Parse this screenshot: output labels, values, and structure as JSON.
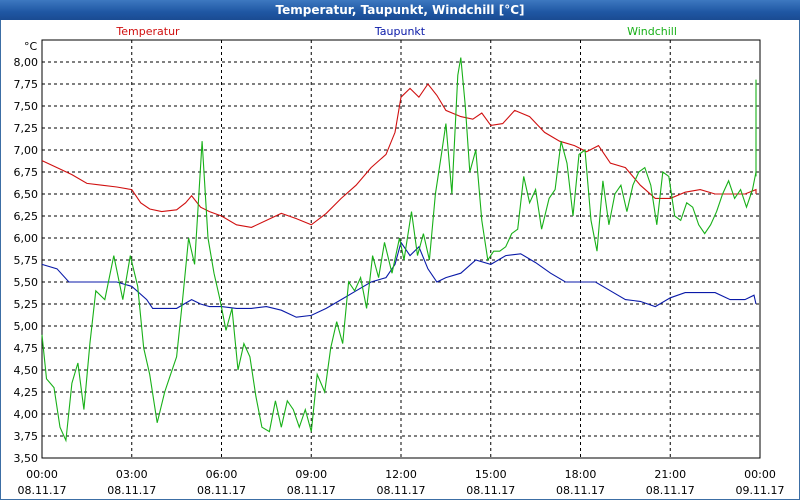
{
  "window": {
    "title": "Temperatur, Taupunkt, Windchill [°C]"
  },
  "chart_data": {
    "type": "line",
    "title": "Temperatur, Taupunkt, Windchill [°C]",
    "ylabel": "°C",
    "xlabel": "",
    "ylim": [
      3.5,
      8.25
    ],
    "xlim": [
      0,
      24
    ],
    "grid": true,
    "legend_placement": "top",
    "x_ticks": [
      {
        "x": 0,
        "time": "00:00",
        "date": "08.11.17"
      },
      {
        "x": 3,
        "time": "03:00",
        "date": "08.11.17"
      },
      {
        "x": 6,
        "time": "06:00",
        "date": "08.11.17"
      },
      {
        "x": 9,
        "time": "09:00",
        "date": "08.11.17"
      },
      {
        "x": 12,
        "time": "12:00",
        "date": "08.11.17"
      },
      {
        "x": 15,
        "time": "15:00",
        "date": "08.11.17"
      },
      {
        "x": 18,
        "time": "18:00",
        "date": "08.11.17"
      },
      {
        "x": 21,
        "time": "21:00",
        "date": "08.11.17"
      },
      {
        "x": 24,
        "time": "00:00",
        "date": "09.11.17"
      }
    ],
    "y_ticks": [
      "3,50",
      "3,75",
      "4,00",
      "4,25",
      "4,50",
      "4,75",
      "5,00",
      "5,25",
      "5,50",
      "5,75",
      "6,00",
      "6,25",
      "6,50",
      "6,75",
      "7,00",
      "7,25",
      "7,50",
      "7,75",
      "8,00"
    ],
    "series": [
      {
        "name": "Temperatur",
        "color": "#d01010",
        "points": [
          [
            0,
            6.88
          ],
          [
            0.5,
            6.8
          ],
          [
            1,
            6.72
          ],
          [
            1.5,
            6.62
          ],
          [
            2,
            6.6
          ],
          [
            2.5,
            6.58
          ],
          [
            3,
            6.55
          ],
          [
            3.3,
            6.4
          ],
          [
            3.6,
            6.33
          ],
          [
            4,
            6.3
          ],
          [
            4.5,
            6.32
          ],
          [
            4.8,
            6.4
          ],
          [
            5,
            6.48
          ],
          [
            5.3,
            6.35
          ],
          [
            5.6,
            6.3
          ],
          [
            6,
            6.25
          ],
          [
            6.5,
            6.15
          ],
          [
            7,
            6.12
          ],
          [
            7.5,
            6.2
          ],
          [
            8,
            6.28
          ],
          [
            8.5,
            6.22
          ],
          [
            9,
            6.15
          ],
          [
            9.5,
            6.28
          ],
          [
            10,
            6.45
          ],
          [
            10.5,
            6.6
          ],
          [
            11,
            6.8
          ],
          [
            11.5,
            6.95
          ],
          [
            11.8,
            7.2
          ],
          [
            12,
            7.6
          ],
          [
            12.3,
            7.7
          ],
          [
            12.6,
            7.6
          ],
          [
            12.9,
            7.75
          ],
          [
            13.2,
            7.62
          ],
          [
            13.5,
            7.45
          ],
          [
            14,
            7.38
          ],
          [
            14.4,
            7.35
          ],
          [
            14.7,
            7.42
          ],
          [
            15,
            7.28
          ],
          [
            15.4,
            7.3
          ],
          [
            15.8,
            7.45
          ],
          [
            16.3,
            7.38
          ],
          [
            16.8,
            7.2
          ],
          [
            17.3,
            7.1
          ],
          [
            17.8,
            7.05
          ],
          [
            18.2,
            6.98
          ],
          [
            18.6,
            7.05
          ],
          [
            19,
            6.85
          ],
          [
            19.5,
            6.8
          ],
          [
            20,
            6.6
          ],
          [
            20.5,
            6.45
          ],
          [
            21,
            6.45
          ],
          [
            21.5,
            6.52
          ],
          [
            22,
            6.55
          ],
          [
            22.5,
            6.5
          ],
          [
            23,
            6.5
          ],
          [
            23.5,
            6.5
          ],
          [
            23.9,
            6.55
          ],
          [
            24,
            6.5
          ]
        ]
      },
      {
        "name": "Taupunkt",
        "color": "#0a1aa8",
        "points": [
          [
            0,
            5.7
          ],
          [
            0.5,
            5.65
          ],
          [
            0.9,
            5.5
          ],
          [
            1.5,
            5.5
          ],
          [
            2,
            5.5
          ],
          [
            2.5,
            5.5
          ],
          [
            3,
            5.45
          ],
          [
            3.5,
            5.3
          ],
          [
            3.7,
            5.2
          ],
          [
            4,
            5.2
          ],
          [
            4.5,
            5.2
          ],
          [
            5,
            5.3
          ],
          [
            5.3,
            5.25
          ],
          [
            5.6,
            5.22
          ],
          [
            6,
            5.22
          ],
          [
            6.5,
            5.2
          ],
          [
            7,
            5.2
          ],
          [
            7.5,
            5.22
          ],
          [
            8,
            5.18
          ],
          [
            8.5,
            5.1
          ],
          [
            9,
            5.12
          ],
          [
            9.5,
            5.2
          ],
          [
            10,
            5.3
          ],
          [
            10.5,
            5.4
          ],
          [
            11,
            5.5
          ],
          [
            11.5,
            5.55
          ],
          [
            11.8,
            5.7
          ],
          [
            12,
            5.95
          ],
          [
            12.3,
            5.8
          ],
          [
            12.6,
            5.9
          ],
          [
            12.9,
            5.65
          ],
          [
            13.2,
            5.5
          ],
          [
            13.5,
            5.55
          ],
          [
            14,
            5.6
          ],
          [
            14.5,
            5.75
          ],
          [
            15,
            5.7
          ],
          [
            15.5,
            5.8
          ],
          [
            16,
            5.82
          ],
          [
            16.5,
            5.72
          ],
          [
            17,
            5.6
          ],
          [
            17.5,
            5.5
          ],
          [
            18,
            5.5
          ],
          [
            18.5,
            5.5
          ],
          [
            19,
            5.4
          ],
          [
            19.5,
            5.3
          ],
          [
            20,
            5.28
          ],
          [
            20.5,
            5.22
          ],
          [
            21,
            5.32
          ],
          [
            21.5,
            5.38
          ],
          [
            22,
            5.38
          ],
          [
            22.5,
            5.38
          ],
          [
            23,
            5.3
          ],
          [
            23.5,
            5.3
          ],
          [
            23.8,
            5.35
          ],
          [
            24,
            5.25
          ]
        ]
      },
      {
        "name": "Windchill",
        "color": "#18b018",
        "points": [
          [
            0,
            4.9
          ],
          [
            0.15,
            4.4
          ],
          [
            0.4,
            4.3
          ],
          [
            0.6,
            3.85
          ],
          [
            0.8,
            3.7
          ],
          [
            1,
            4.35
          ],
          [
            1.2,
            4.58
          ],
          [
            1.4,
            4.05
          ],
          [
            1.6,
            4.8
          ],
          [
            1.8,
            5.4
          ],
          [
            2.1,
            5.3
          ],
          [
            2.4,
            5.8
          ],
          [
            2.7,
            5.3
          ],
          [
            2.95,
            5.8
          ],
          [
            3.2,
            5.45
          ],
          [
            3.4,
            4.75
          ],
          [
            3.6,
            4.45
          ],
          [
            3.85,
            3.9
          ],
          [
            4.1,
            4.25
          ],
          [
            4.3,
            4.45
          ],
          [
            4.5,
            4.65
          ],
          [
            4.7,
            5.3
          ],
          [
            4.9,
            6.0
          ],
          [
            5.1,
            5.7
          ],
          [
            5.35,
            7.1
          ],
          [
            5.55,
            6.0
          ],
          [
            5.75,
            5.6
          ],
          [
            5.95,
            5.3
          ],
          [
            6.15,
            4.95
          ],
          [
            6.35,
            5.2
          ],
          [
            6.55,
            4.5
          ],
          [
            6.75,
            4.8
          ],
          [
            6.95,
            4.65
          ],
          [
            7.15,
            4.2
          ],
          [
            7.35,
            3.85
          ],
          [
            7.6,
            3.8
          ],
          [
            7.8,
            4.15
          ],
          [
            8.0,
            3.85
          ],
          [
            8.2,
            4.15
          ],
          [
            8.4,
            4.05
          ],
          [
            8.6,
            3.85
          ],
          [
            8.8,
            4.05
          ],
          [
            9.0,
            3.8
          ],
          [
            9.2,
            4.45
          ],
          [
            9.45,
            4.25
          ],
          [
            9.65,
            4.75
          ],
          [
            9.85,
            5.05
          ],
          [
            10.05,
            4.8
          ],
          [
            10.25,
            5.5
          ],
          [
            10.45,
            5.4
          ],
          [
            10.65,
            5.55
          ],
          [
            10.85,
            5.2
          ],
          [
            11.05,
            5.8
          ],
          [
            11.25,
            5.55
          ],
          [
            11.45,
            5.95
          ],
          [
            11.7,
            5.6
          ],
          [
            11.95,
            6.0
          ],
          [
            12.1,
            5.75
          ],
          [
            12.35,
            6.3
          ],
          [
            12.55,
            5.8
          ],
          [
            12.75,
            6.05
          ],
          [
            12.95,
            5.75
          ],
          [
            13.15,
            6.5
          ],
          [
            13.35,
            6.95
          ],
          [
            13.5,
            7.3
          ],
          [
            13.7,
            6.5
          ],
          [
            13.9,
            7.85
          ],
          [
            14.0,
            8.05
          ],
          [
            14.15,
            7.5
          ],
          [
            14.3,
            6.75
          ],
          [
            14.5,
            7.0
          ],
          [
            14.7,
            6.2
          ],
          [
            14.9,
            5.75
          ],
          [
            15.1,
            5.85
          ],
          [
            15.3,
            5.85
          ],
          [
            15.5,
            5.9
          ],
          [
            15.7,
            6.05
          ],
          [
            15.9,
            6.1
          ],
          [
            16.1,
            6.7
          ],
          [
            16.3,
            6.4
          ],
          [
            16.5,
            6.55
          ],
          [
            16.7,
            6.1
          ],
          [
            16.95,
            6.45
          ],
          [
            17.15,
            6.55
          ],
          [
            17.35,
            7.1
          ],
          [
            17.55,
            6.85
          ],
          [
            17.75,
            6.25
          ],
          [
            17.95,
            6.95
          ],
          [
            18.15,
            7.0
          ],
          [
            18.35,
            6.2
          ],
          [
            18.55,
            5.85
          ],
          [
            18.75,
            6.65
          ],
          [
            18.95,
            6.15
          ],
          [
            19.15,
            6.5
          ],
          [
            19.35,
            6.6
          ],
          [
            19.55,
            6.3
          ],
          [
            19.75,
            6.6
          ],
          [
            19.95,
            6.75
          ],
          [
            20.15,
            6.8
          ],
          [
            20.35,
            6.6
          ],
          [
            20.55,
            6.15
          ],
          [
            20.75,
            6.75
          ],
          [
            20.95,
            6.7
          ],
          [
            21.15,
            6.25
          ],
          [
            21.35,
            6.2
          ],
          [
            21.55,
            6.4
          ],
          [
            21.75,
            6.35
          ],
          [
            21.95,
            6.15
          ],
          [
            22.15,
            6.05
          ],
          [
            22.35,
            6.15
          ],
          [
            22.55,
            6.3
          ],
          [
            22.75,
            6.5
          ],
          [
            22.95,
            6.65
          ],
          [
            23.15,
            6.45
          ],
          [
            23.35,
            6.55
          ],
          [
            23.55,
            6.35
          ],
          [
            23.75,
            6.55
          ],
          [
            23.95,
            6.75
          ],
          [
            24.15,
            7.05
          ],
          [
            24.35,
            7.8
          ],
          [
            24.45,
            7.1
          ],
          [
            24.5,
            6.7
          ]
        ]
      }
    ]
  }
}
